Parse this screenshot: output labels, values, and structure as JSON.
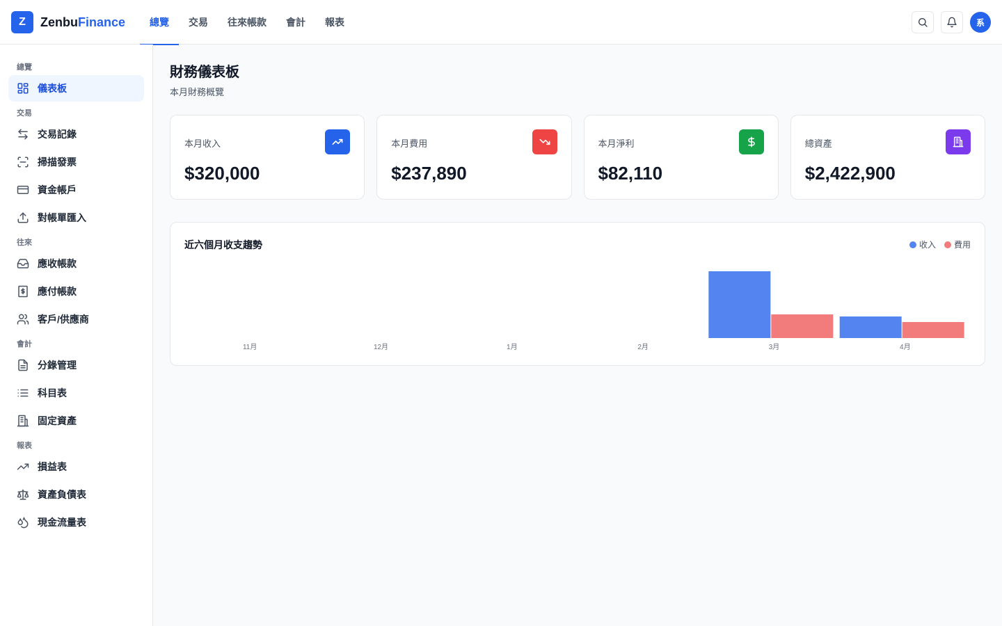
{
  "app": {
    "logo_letter": "Z",
    "name_main": "Zenbu",
    "name_accent": "Finance"
  },
  "topnav": [
    {
      "label": "總覽",
      "active": true
    },
    {
      "label": "交易",
      "active": false
    },
    {
      "label": "往來帳款",
      "active": false
    },
    {
      "label": "會計",
      "active": false
    },
    {
      "label": "報表",
      "active": false
    }
  ],
  "user": {
    "avatar_text": "系"
  },
  "sidebar": {
    "sections": [
      {
        "label": "總覽",
        "items": [
          {
            "label": "儀表板",
            "icon": "grid-icon",
            "active": true
          }
        ]
      },
      {
        "label": "交易",
        "items": [
          {
            "label": "交易記錄",
            "icon": "arrows-exchange-icon"
          },
          {
            "label": "掃描發票",
            "icon": "scan-icon"
          },
          {
            "label": "資金帳戶",
            "icon": "credit-card-icon"
          },
          {
            "label": "對帳單匯入",
            "icon": "upload-icon"
          }
        ]
      },
      {
        "label": "往來",
        "items": [
          {
            "label": "應收帳款",
            "icon": "inbox-icon"
          },
          {
            "label": "應付帳款",
            "icon": "receipt-dollar-icon"
          },
          {
            "label": "客戶/供應商",
            "icon": "users-icon"
          }
        ]
      },
      {
        "label": "會計",
        "items": [
          {
            "label": "分錄管理",
            "icon": "file-text-icon"
          },
          {
            "label": "科目表",
            "icon": "list-icon"
          },
          {
            "label": "固定資產",
            "icon": "building-icon"
          }
        ]
      },
      {
        "label": "報表",
        "items": [
          {
            "label": "損益表",
            "icon": "trending-up-icon"
          },
          {
            "label": "資產負債表",
            "icon": "scale-icon"
          },
          {
            "label": "現金流量表",
            "icon": "droplets-icon"
          }
        ]
      }
    ]
  },
  "page": {
    "title": "財務儀表板",
    "subtitle": "本月財務概覽"
  },
  "stats": [
    {
      "label": "本月收入",
      "value": "$320,000",
      "icon": "trending-up-icon",
      "color": "#2563eb"
    },
    {
      "label": "本月費用",
      "value": "$237,890",
      "icon": "trending-down-icon",
      "color": "#ef4444"
    },
    {
      "label": "本月淨利",
      "value": "$82,110",
      "icon": "dollar-icon",
      "color": "#16a34a"
    },
    {
      "label": "總資產",
      "value": "$2,422,900",
      "icon": "building-icon",
      "color": "#7c3aed"
    }
  ],
  "chart": {
    "title": "近六個月收支趨勢",
    "colors": {
      "income": "#5384f0",
      "expense": "#f27b7b"
    }
  },
  "chart_data": {
    "type": "bar",
    "categories": [
      "11月",
      "12月",
      "1月",
      "2月",
      "3月",
      "4月"
    ],
    "series": [
      {
        "name": "收入",
        "values": [
          0,
          0,
          0,
          0,
          320000,
          102000
        ]
      },
      {
        "name": "費用",
        "values": [
          0,
          0,
          0,
          0,
          112000,
          75000
        ]
      }
    ],
    "ylim": [
      0,
      320000
    ],
    "grid": false,
    "legend": "top-right"
  }
}
